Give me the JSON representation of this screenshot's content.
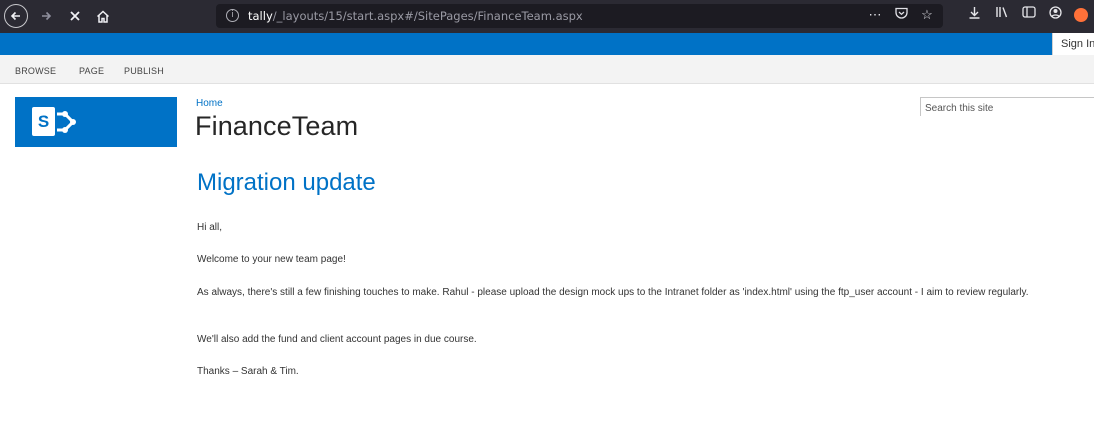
{
  "browser": {
    "url_host": "tally",
    "url_path": "/_layouts/15/start.aspx#/SitePages/FinanceTeam.aspx",
    "icons": {
      "back": "back-arrow-icon",
      "forward": "forward-arrow-icon",
      "stop": "stop-loading-icon",
      "home": "home-icon",
      "info": "info-icon",
      "more": "more-actions-icon",
      "pocket": "pocket-icon",
      "bookmark": "bookmark-star-icon",
      "download": "download-icon",
      "library": "library-icon",
      "sidebar": "sidebar-icon",
      "account": "account-icon",
      "extension": "extension-icon"
    }
  },
  "suite_bar": {
    "signin_label": "Sign In",
    "color": "#0072c6"
  },
  "ribbon": {
    "tabs": [
      {
        "label": "BROWSE"
      },
      {
        "label": "PAGE"
      },
      {
        "label": "PUBLISH"
      }
    ]
  },
  "site": {
    "breadcrumb": "Home",
    "title": "FinanceTeam",
    "logo_letter": "S",
    "search_placeholder": "Search this site"
  },
  "content": {
    "heading": "Migration update",
    "paragraphs": [
      "Hi all,",
      "Welcome to your new team page!",
      "As always, there's still a few finishing touches to make.  Rahul - please upload the design mock ups to the Intranet folder as 'index.html' using the ftp_user account - I aim to review regularly.",
      "We'll also add the fund and client account pages in due course.",
      "Thanks – Sarah & Tim."
    ]
  },
  "colors": {
    "brand": "#0072c6",
    "browser_chrome": "#2b2a33",
    "text": "#333333"
  }
}
